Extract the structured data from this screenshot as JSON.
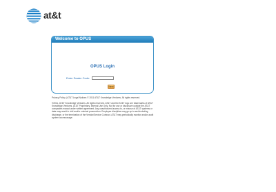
{
  "brand": {
    "wordmark": "at&t"
  },
  "panel": {
    "header": "Welcome to OPUS",
    "title": "OPUS Login",
    "field_label": "Enter Dealer Code:",
    "field_value": "",
    "next_label": "Next"
  },
  "footer": {
    "privacy_link": "Privacy Policy",
    "legal_link": "AT&T Legal Notices",
    "copyright": "© 2011 AT&T Knowledge Ventures. All rights reserved.",
    "legal_text": "©2011, AT&T Knowledge Ventures. All rights reserved. AT&T and the AT&T logo are trademarks of AT&T Knowledge Ventures. AT&T Proprietary. Internal Use Only. Not for use or disclosure outside the AT&T companies except under written agreement. Any unauthorized access to, or misuse of AT&T systems or data may result in civil and/or criminal prosecution. Employee discipline may go up to and including discharge, or the termination of the Vendor/Service Contract. AT&T may periodically monitor and/or audit system accessusage."
  },
  "colors": {
    "accent": "#1f7bb8",
    "button": "#f0a43a"
  }
}
